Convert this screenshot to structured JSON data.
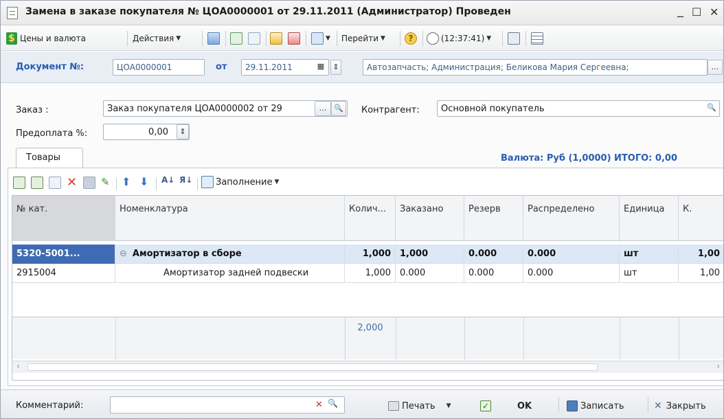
{
  "window": {
    "title": "Замена в заказе покупателя № ЦОА0000001 от 29.11.2011 (Администратор) Проведен",
    "controls": {
      "minimize": "_",
      "maximize": "☐",
      "close": "✕"
    }
  },
  "toolbar": {
    "prices_currency": "Цены и валюта",
    "actions": "Действия",
    "goto": "Перейти",
    "help": "?",
    "time": "(12:37:41)"
  },
  "document": {
    "number_label": "Документ №:",
    "number": "ЦОА0000001",
    "from_label": "от",
    "date": "29.11.2011",
    "org_info": "Автозапчасть; Администрация; Беликова Мария Сергеевна;",
    "more": "..."
  },
  "form": {
    "order_label": "Заказ :",
    "order_value": "Заказ покупателя ЦОА0000002 от 29",
    "counterparty_label": "Контрагент:",
    "counterparty_value": "Основной покупатель",
    "prepay_label": "Предоплата %:",
    "prepay_value": "0,00"
  },
  "tabs": {
    "goods": "Товары",
    "currency_total": "Валюта: Руб (1,0000) ИТОГО: 0,00"
  },
  "grid_toolbar": {
    "fill": "Заполнение"
  },
  "grid": {
    "columns": [
      "№ кат.",
      "Номенклатура",
      "Колич...",
      "Заказано",
      "Резерв",
      "Распределено",
      "Единица",
      "К."
    ],
    "rows": [
      {
        "cat": "5320-5001...",
        "name": "Амортизатор в сборе",
        "qty": "1,000",
        "ordered": "1,000",
        "reserve": "0.000",
        "distributed": "0.000",
        "unit": "шт",
        "k": "1,00"
      },
      {
        "cat": "2915004",
        "name": "Амортизатор задней подвески",
        "qty": "1,000",
        "ordered": "0.000",
        "reserve": "0.000",
        "distributed": "0.000",
        "unit": "шт",
        "k": "1,00"
      }
    ],
    "group_toggle": "⊖",
    "total_qty": "2,000"
  },
  "bottom": {
    "comment_label": "Комментарий:",
    "print": "Печать",
    "ok": "OK",
    "save": "Записать",
    "close": "Закрыть"
  },
  "colors": {
    "accent": "#3f6bb4",
    "link": "#2a5db0",
    "selection": "#dde8f6"
  }
}
